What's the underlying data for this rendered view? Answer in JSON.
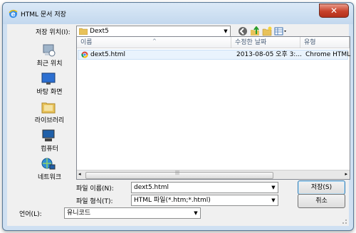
{
  "window": {
    "title": "HTML 문서 저장",
    "close_label": "✕"
  },
  "location": {
    "label": "저장 위치(I):",
    "value": "Dext5"
  },
  "toolbar": {
    "icons": [
      "back-icon",
      "up-folder-icon",
      "new-folder-icon",
      "view-menu-icon"
    ]
  },
  "places": [
    {
      "label": "최근 위치",
      "icon": "recent-places-icon"
    },
    {
      "label": "바탕 화면",
      "icon": "desktop-icon"
    },
    {
      "label": "라이브러리",
      "icon": "libraries-icon"
    },
    {
      "label": "컴퓨터",
      "icon": "computer-icon"
    },
    {
      "label": "네트워크",
      "icon": "network-icon"
    }
  ],
  "file_list": {
    "columns": {
      "name": "이름",
      "modified": "수정한 날짜",
      "type": "유형"
    },
    "rows": [
      {
        "name": "dext5.html",
        "modified": "2013-08-05 오후 3:...",
        "type": "Chrome HTML"
      }
    ]
  },
  "filename": {
    "label": "파일 이름(N):",
    "value": "dext5.html"
  },
  "filetype": {
    "label": "파일 형식(T):",
    "value": "HTML 파일(*.htm;*.html)"
  },
  "encoding": {
    "label": "언어(L):",
    "value": "유니코드"
  },
  "buttons": {
    "save": "저장(S)",
    "cancel": "취소"
  },
  "colors": {
    "selection": "#e9f3fd",
    "title_bar": "#cfe0f2",
    "close": "#c7422a"
  }
}
